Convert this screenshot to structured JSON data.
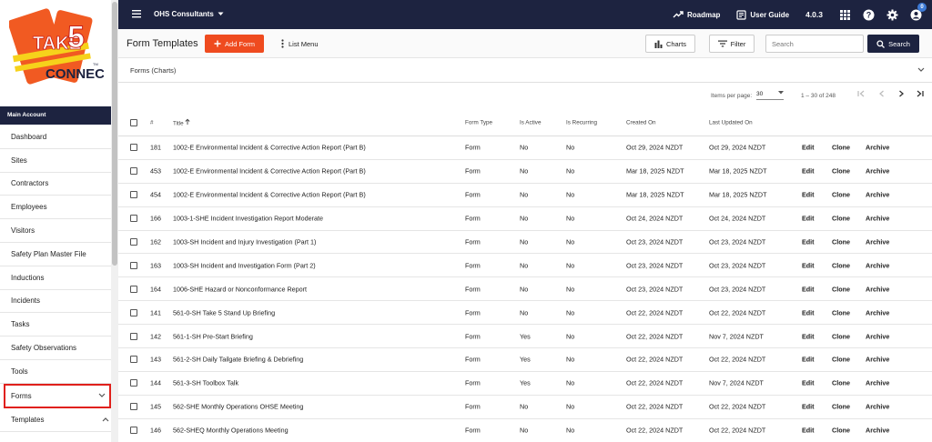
{
  "logo": {
    "line1": "TAKE",
    "digit": "5",
    "line2": "CONNECT",
    "tm": "TM",
    "colors": {
      "orange": "#f15a22",
      "yellow": "#f6d21b",
      "red": "#c8221b",
      "navy": "#1d2340"
    }
  },
  "sidebar": {
    "section": "Main Account",
    "items": [
      {
        "label": "Dashboard"
      },
      {
        "label": "Sites"
      },
      {
        "label": "Contractors"
      },
      {
        "label": "Employees"
      },
      {
        "label": "Visitors"
      },
      {
        "label": "Safety Plan Master File"
      },
      {
        "label": "Inductions"
      },
      {
        "label": "Incidents"
      },
      {
        "label": "Tasks"
      },
      {
        "label": "Safety Observations"
      },
      {
        "label": "Tools"
      },
      {
        "label": "Forms",
        "chevron": "chevron-down-icon",
        "highlighted": true
      },
      {
        "label": "Templates",
        "chevron": "chevron-up-icon"
      }
    ]
  },
  "topbar": {
    "org": "OHS Consultants",
    "roadmap": "Roadmap",
    "user_guide": "User Guide",
    "version": "4.0.3",
    "notification_count": "0",
    "bg": "#1d2340"
  },
  "toolbar": {
    "title": "Form Templates",
    "add_label": "Add Form",
    "list_menu": "List Menu",
    "charts": "Charts",
    "filter": "Filter",
    "search_placeholder": "Search",
    "search_button": "Search",
    "accent": "#ef4b1f"
  },
  "charts_panel": {
    "label": "Forms (Charts)"
  },
  "paginator": {
    "items_label": "Items per page:",
    "per_page": "30",
    "range": "1 – 30 of 248"
  },
  "table": {
    "headers": {
      "num": "#",
      "title": "Title",
      "type": "Form Type",
      "active": "Is Active",
      "recurring": "Is Recurring",
      "created": "Created On",
      "updated": "Last Updated On"
    },
    "actions": {
      "edit": "Edit",
      "clone": "Clone",
      "archive": "Archive"
    },
    "rows": [
      {
        "num": "181",
        "title": "1002-E Environmental Incident & Corrective Action Report (Part B)",
        "type": "Form",
        "active": "No",
        "recurring": "No",
        "created": "Oct 29, 2024 NZDT",
        "updated": "Oct 29, 2024 NZDT"
      },
      {
        "num": "453",
        "title": "1002-E Environmental Incident & Corrective Action Report (Part B)",
        "type": "Form",
        "active": "No",
        "recurring": "No",
        "created": "Mar 18, 2025 NZDT",
        "updated": "Mar 18, 2025 NZDT"
      },
      {
        "num": "454",
        "title": "1002-E Environmental Incident & Corrective Action Report (Part B)",
        "type": "Form",
        "active": "No",
        "recurring": "No",
        "created": "Mar 18, 2025 NZDT",
        "updated": "Mar 18, 2025 NZDT"
      },
      {
        "num": "166",
        "title": "1003-1-SHE Incident Investigation Report Moderate",
        "type": "Form",
        "active": "No",
        "recurring": "No",
        "created": "Oct 24, 2024 NZDT",
        "updated": "Oct 24, 2024 NZDT"
      },
      {
        "num": "162",
        "title": "1003-SH Incident and Injury Investigation (Part 1)",
        "type": "Form",
        "active": "No",
        "recurring": "No",
        "created": "Oct 23, 2024 NZDT",
        "updated": "Oct 23, 2024 NZDT"
      },
      {
        "num": "163",
        "title": "1003-SH Incident and Investigation Form (Part 2)",
        "type": "Form",
        "active": "No",
        "recurring": "No",
        "created": "Oct 23, 2024 NZDT",
        "updated": "Oct 23, 2024 NZDT"
      },
      {
        "num": "164",
        "title": "1006-SHE Hazard or Nonconformance Report",
        "type": "Form",
        "active": "No",
        "recurring": "No",
        "created": "Oct 23, 2024 NZDT",
        "updated": "Oct 23, 2024 NZDT"
      },
      {
        "num": "141",
        "title": "561-0-SH Take 5 Stand Up Briefing",
        "type": "Form",
        "active": "No",
        "recurring": "No",
        "created": "Oct 22, 2024 NZDT",
        "updated": "Oct 22, 2024 NZDT"
      },
      {
        "num": "142",
        "title": "561-1-SH Pre-Start Briefing",
        "type": "Form",
        "active": "Yes",
        "recurring": "No",
        "created": "Oct 22, 2024 NZDT",
        "updated": "Nov 7, 2024 NZDT"
      },
      {
        "num": "143",
        "title": "561-2-SH Daily Tailgate Briefing & Debriefing",
        "type": "Form",
        "active": "Yes",
        "recurring": "No",
        "created": "Oct 22, 2024 NZDT",
        "updated": "Oct 22, 2024 NZDT"
      },
      {
        "num": "144",
        "title": "561-3-SH Toolbox Talk",
        "type": "Form",
        "active": "Yes",
        "recurring": "No",
        "created": "Oct 22, 2024 NZDT",
        "updated": "Nov 7, 2024 NZDT"
      },
      {
        "num": "145",
        "title": "562-SHE Monthly Operations OHSE Meeting",
        "type": "Form",
        "active": "No",
        "recurring": "No",
        "created": "Oct 22, 2024 NZDT",
        "updated": "Oct 22, 2024 NZDT"
      },
      {
        "num": "146",
        "title": "562-SHEQ Monthly Operations Meeting",
        "type": "Form",
        "active": "No",
        "recurring": "No",
        "created": "Oct 22, 2024 NZDT",
        "updated": "Oct 22, 2024 NZDT"
      }
    ]
  }
}
